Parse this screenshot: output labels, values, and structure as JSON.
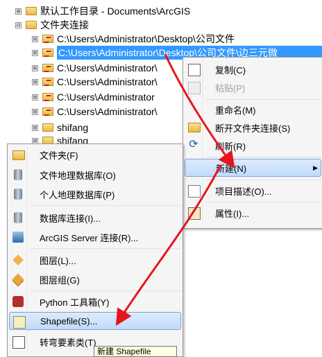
{
  "tree": {
    "rows": [
      {
        "label": "默认工作目录 - Documents\\ArcGIS",
        "expander": "⊞",
        "icon": "folder-home-icon"
      },
      {
        "label": "文件夹连接",
        "expander": "⊟",
        "icon": "folder-connections-icon"
      },
      {
        "label": "C:\\Users\\Administrator\\Desktop\\公司文件",
        "expander": "⊞",
        "icon": "folder-connection-icon"
      },
      {
        "label": "C:\\Users\\Administrator\\Desktop\\公司文件\\边三元微",
        "expander": "⊞",
        "icon": "folder-connection-icon",
        "selected": true
      },
      {
        "label": "C:\\Users\\Administrator\\",
        "expander": "⊞",
        "icon": "folder-connection-icon"
      },
      {
        "label": "C:\\Users\\Administrator\\",
        "expander": "⊞",
        "icon": "folder-connection-icon"
      },
      {
        "label": "C:\\Users\\Administrator",
        "expander": "⊞",
        "icon": "folder-connection-icon"
      },
      {
        "label": "C:\\Users\\Administrator\\",
        "expander": "⊞",
        "icon": "folder-connection-icon"
      },
      {
        "label": "shifang",
        "expander": "⊞",
        "icon": "folder-icon"
      },
      {
        "label": "shifang",
        "expander": "⊞",
        "icon": "folder-icon"
      }
    ]
  },
  "context_menu": {
    "items": [
      {
        "label": "复制(C)",
        "icon": "copy-icon",
        "enabled": true
      },
      {
        "label": "粘贴(P)",
        "icon": "paste-icon",
        "enabled": false
      },
      {
        "label": "重命名(M)",
        "icon": "",
        "enabled": true
      },
      {
        "label": "断开文件夹连接(S)",
        "icon": "disconnect-folder-icon",
        "enabled": true
      },
      {
        "label": "刷新(R)",
        "icon": "refresh-icon",
        "enabled": true
      },
      {
        "label": "新建(N)",
        "icon": "",
        "enabled": true,
        "highlighted": true,
        "submenu_arrow": "▶"
      },
      {
        "label": "项目描述(O)...",
        "icon": "item-description-icon",
        "enabled": true
      },
      {
        "label": "属性(I)...",
        "icon": "properties-icon",
        "enabled": true
      }
    ]
  },
  "new_submenu": {
    "items": [
      {
        "label": "文件夹(F)",
        "icon": "folder-icon"
      },
      {
        "label": "文件地理数据库(O)",
        "icon": "file-geodatabase-icon"
      },
      {
        "label": "个人地理数据库(P)",
        "icon": "personal-geodatabase-icon"
      },
      {
        "label": "数据库连接(I)...",
        "icon": "database-connection-icon"
      },
      {
        "label": "ArcGIS Server 连接(R)...",
        "icon": "arcgis-server-icon"
      },
      {
        "label": "图层(L)...",
        "icon": "layer-icon"
      },
      {
        "label": "图层组(G)",
        "icon": "layer-group-icon"
      },
      {
        "label": "Python 工具箱(Y)",
        "icon": "python-toolbox-icon"
      },
      {
        "label": "Shapefile(S)...",
        "icon": "shapefile-icon",
        "highlighted": true
      },
      {
        "label": "转弯要素类(T)",
        "icon": "turn-feature-class-icon"
      }
    ]
  },
  "tooltip": {
    "text": "新建 Shapefile"
  },
  "colors": {
    "selection": "#3399ff",
    "menu_highlight": "#c1dbfc",
    "arrow": "#e8141c"
  }
}
